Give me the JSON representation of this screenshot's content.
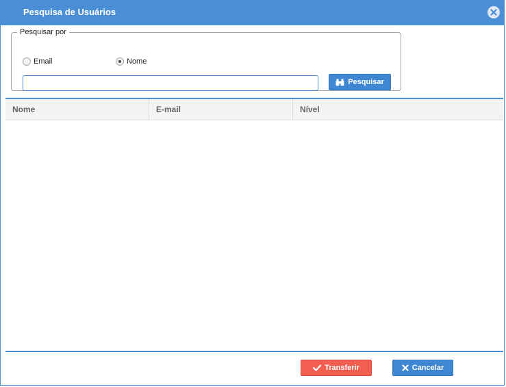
{
  "dialog": {
    "title": "Pesquisa de Usuários"
  },
  "search": {
    "legend": "Pesquisar por",
    "options": [
      {
        "label": "Email",
        "selected": false
      },
      {
        "label": "Nome",
        "selected": true
      }
    ],
    "input_value": "",
    "button_label": "Pesquisar"
  },
  "grid": {
    "columns": [
      "Nome",
      "E-mail",
      "Nível"
    ],
    "rows": []
  },
  "footer": {
    "transfer_label": "Transferir",
    "cancel_label": "Cancelar"
  },
  "colors": {
    "accent": "#4a8fd6",
    "button_blue": "#3f86d3",
    "button_red": "#f25f50"
  },
  "icons": {
    "close": "close-circle-icon",
    "search": "binoculars-icon",
    "transfer": "check-icon",
    "cancel": "x-icon"
  }
}
